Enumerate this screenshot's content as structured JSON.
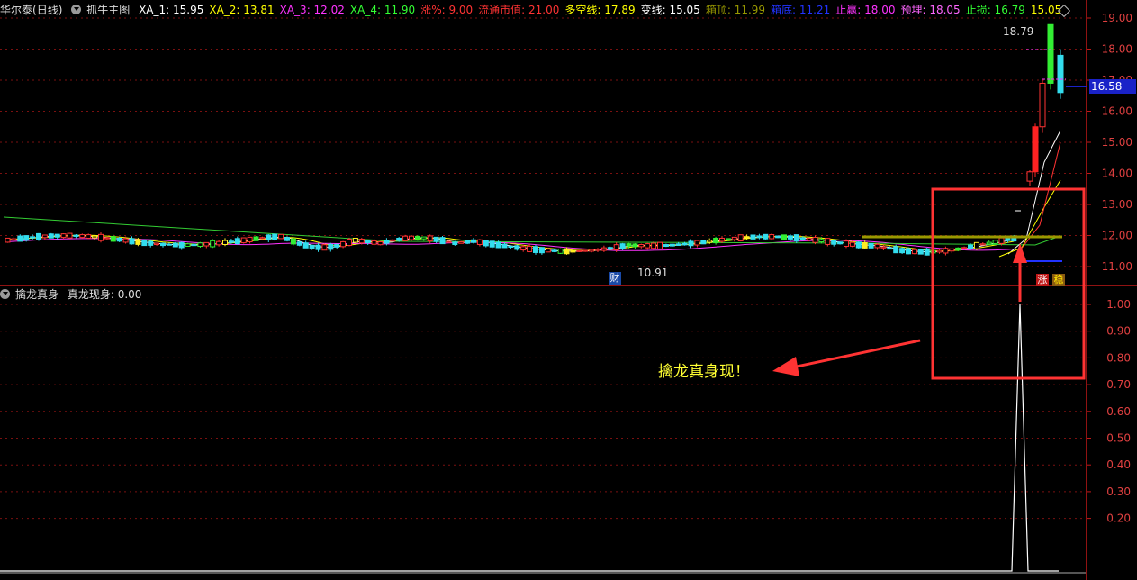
{
  "header": {
    "stock_name": "华尔泰",
    "period": "(日线)",
    "indicator_main": "抓牛主图",
    "values": [
      {
        "label": "XA_1: ",
        "value": "15.95",
        "color": "#ffffff"
      },
      {
        "label": "XA_2: ",
        "value": "13.81",
        "color": "#ffff00"
      },
      {
        "label": "XA_3: ",
        "value": "12.02",
        "color": "#ff33ff"
      },
      {
        "label": "XA_4: ",
        "value": "11.90",
        "color": "#33ff33"
      },
      {
        "label": "涨%: ",
        "value": "9.00",
        "color": "#ff3333"
      },
      {
        "label": "流通市值: ",
        "value": "21.00",
        "color": "#ff3333"
      },
      {
        "label": "多空线: ",
        "value": "17.89",
        "color": "#ffff00"
      },
      {
        "label": "变线: ",
        "value": "15.05",
        "color": "#ffffff"
      },
      {
        "label": "箱顶: ",
        "value": "11.99",
        "color": "#999900"
      },
      {
        "label": "箱底: ",
        "value": "11.21",
        "color": "#2233ff"
      },
      {
        "label": "止赢: ",
        "value": "18.00",
        "color": "#ff33ff"
      },
      {
        "label": "预埋: ",
        "value": "18.05",
        "color": "#ff66ff"
      },
      {
        "label": "止损: ",
        "value": "16.79",
        "color": "#33ff33"
      },
      {
        "label": "",
        "value": "15.05",
        "color": "#ffff00"
      }
    ]
  },
  "sub_header": {
    "indicator_name": "擒龙真身",
    "value_label": "真龙现身: ",
    "value": "0.00"
  },
  "price_axis": {
    "ticks": [
      "19.00",
      "18.00",
      "17.00",
      "16.00",
      "15.00",
      "14.00",
      "13.00",
      "12.00",
      "11.00"
    ],
    "current_price": "16.58"
  },
  "indicator_axis": {
    "ticks": [
      "1.00",
      "0.90",
      "0.80",
      "0.70",
      "0.60",
      "0.50",
      "0.40",
      "0.30",
      "0.20"
    ]
  },
  "annotations": {
    "high_label": "18.79",
    "low_label": "10.91",
    "callout_text": "擒龙真身现！",
    "cai_marker": "财",
    "zhang_marker": "涨",
    "wen_marker": "稳"
  },
  "colors": {
    "up": "#ff3333",
    "down": "#33ddee",
    "grid": "#7a1010",
    "axis": "#c01818",
    "highlight_box": "#ff3333",
    "callout_text": "#ffff33",
    "current_price_tag": "#1a22c8",
    "box_top": "#999900",
    "box_bottom": "#2233ff"
  }
}
